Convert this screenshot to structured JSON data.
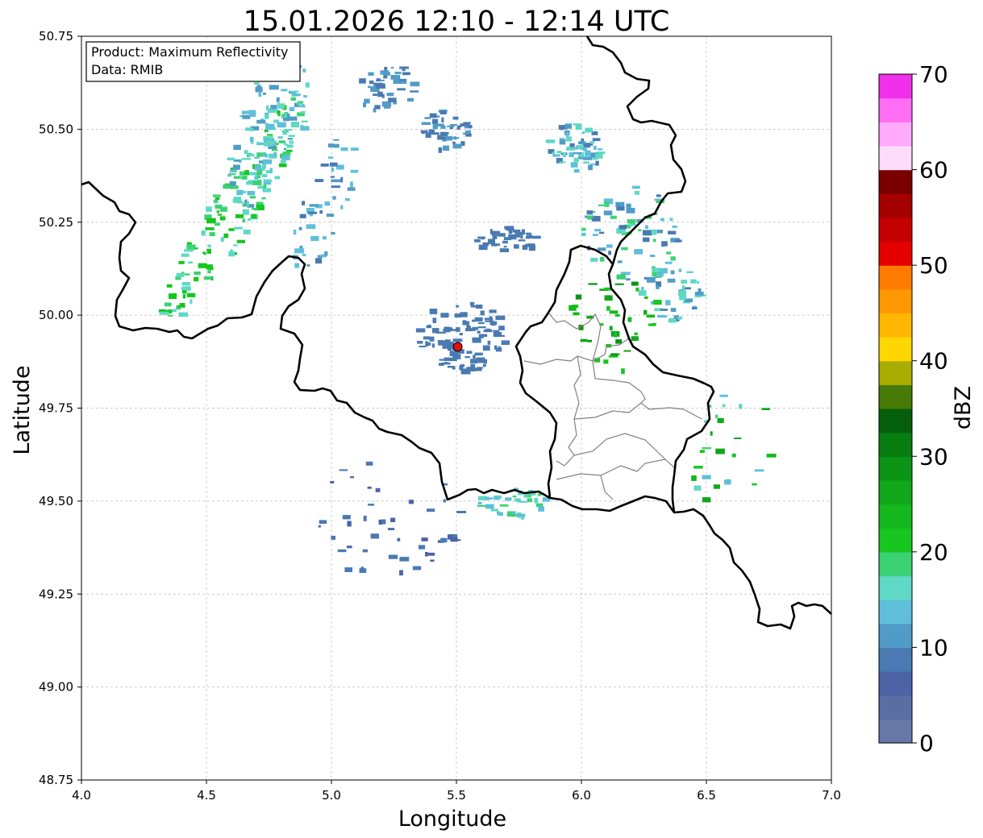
{
  "title": "15.01.2026 12:10 - 12:14 UTC",
  "info_box": {
    "line1": "Product: Maximum Reflectivity",
    "line2": "Data: RMIB"
  },
  "x_axis": {
    "label": "Longitude",
    "min": 4.0,
    "max": 7.0,
    "ticks": [
      "4.0",
      "4.5",
      "5.0",
      "5.5",
      "6.0",
      "6.5",
      "7.0"
    ]
  },
  "y_axis": {
    "label": "Latitude",
    "min": 48.75,
    "max": 50.75,
    "ticks": [
      "48.75",
      "49.00",
      "49.25",
      "49.50",
      "49.75",
      "50.00",
      "50.25",
      "50.50",
      "50.75"
    ]
  },
  "grid": true,
  "radar_site": {
    "lon": 5.505,
    "lat": 49.915,
    "color": "#e01010"
  },
  "colorbar": {
    "label": "dBZ",
    "min": 0,
    "max": 70,
    "step": 2.5,
    "ticks": [
      "0",
      "10",
      "20",
      "30",
      "40",
      "50",
      "60",
      "70"
    ],
    "colors": [
      "#6677a8",
      "#5a6ea5",
      "#4c63a6",
      "#4a7ab1",
      "#509cc6",
      "#5fbfda",
      "#5fd8c6",
      "#3ad272",
      "#17c61f",
      "#14b81c",
      "#10a81a",
      "#0b9416",
      "#077c11",
      "#045e0b",
      "#477a06",
      "#a9ad00",
      "#ffd700",
      "#ffb700",
      "#ff9800",
      "#ff7b00",
      "#e50000",
      "#c40000",
      "#a50000",
      "#7a0000",
      "#ffdcfc",
      "#ffaafa",
      "#ff6ef5",
      "#f030ea"
    ]
  },
  "legend_colors": {
    "border": "#000000",
    "province": "#808080",
    "grid": "#bbbbbb"
  }
}
